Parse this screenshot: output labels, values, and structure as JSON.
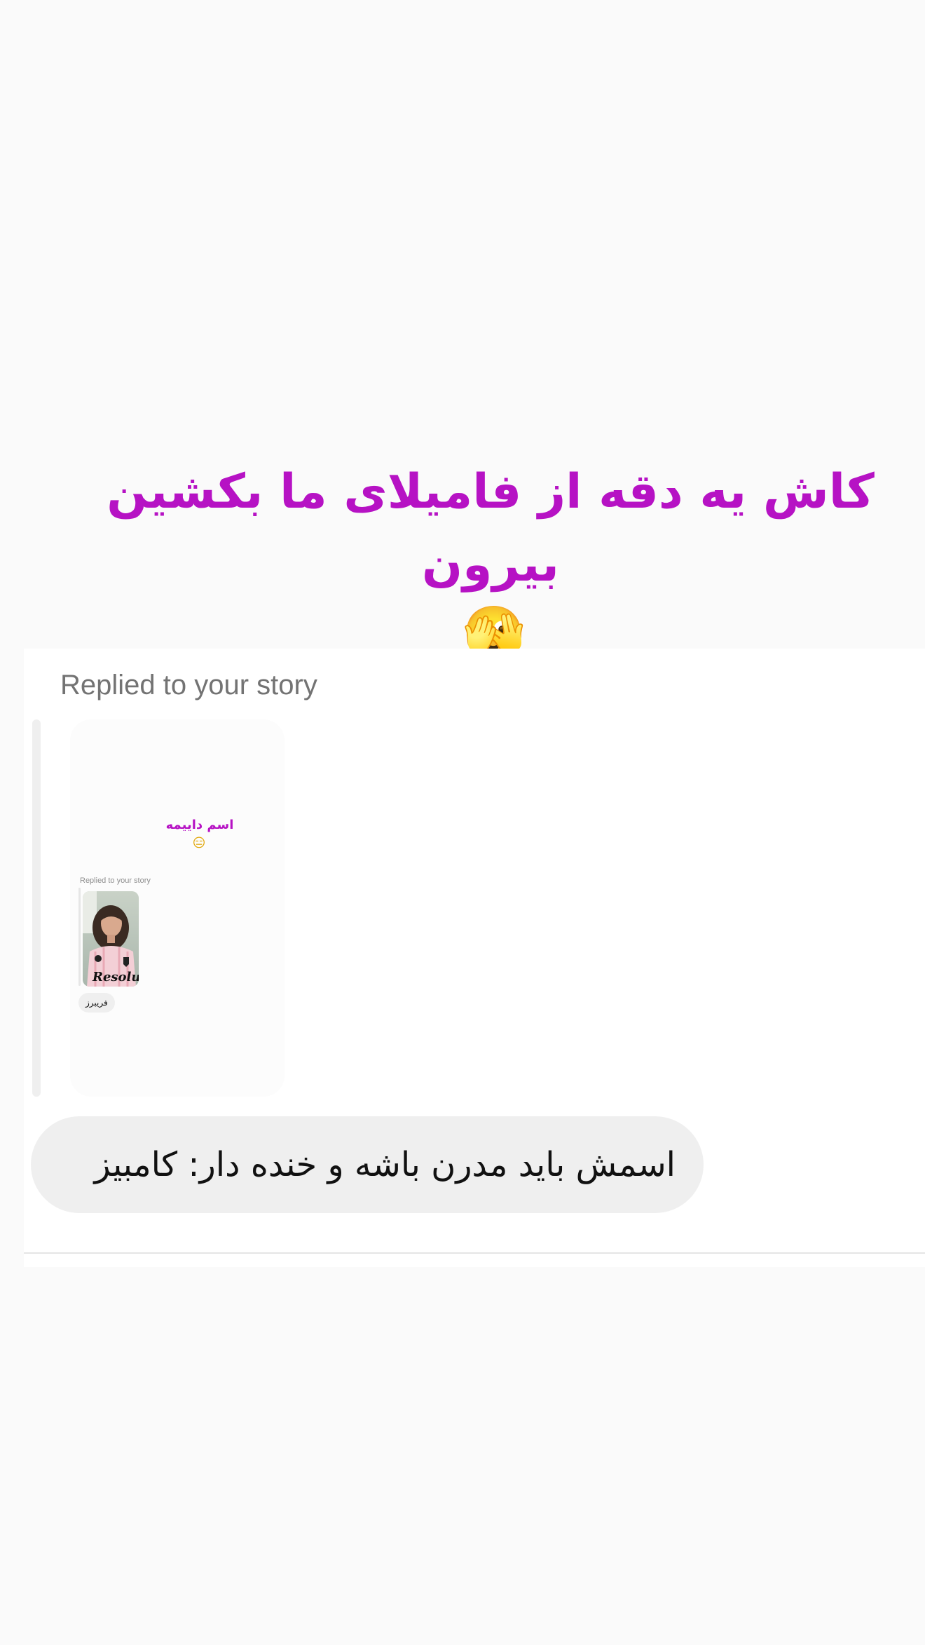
{
  "story": {
    "headline": "کاش یه دقه از فامیلای ما بکشین بیرون",
    "emoji": "🫣"
  },
  "reply_card": {
    "label": "Replied to your story",
    "thumbnail": {
      "text": "اسم دایيمه",
      "emoji": "😑",
      "replied_label": "Replied to your story",
      "bubble_text": "فریبرز",
      "photo_alt": "woman-in-pink-shirt-selfie"
    }
  },
  "message": {
    "text": "اسمش باید مدرن باشه و خنده دار: کامبیز"
  },
  "colors": {
    "background": "#fafafa",
    "headline": "#b612c4",
    "bubble": "#efefef",
    "label": "#737373"
  }
}
